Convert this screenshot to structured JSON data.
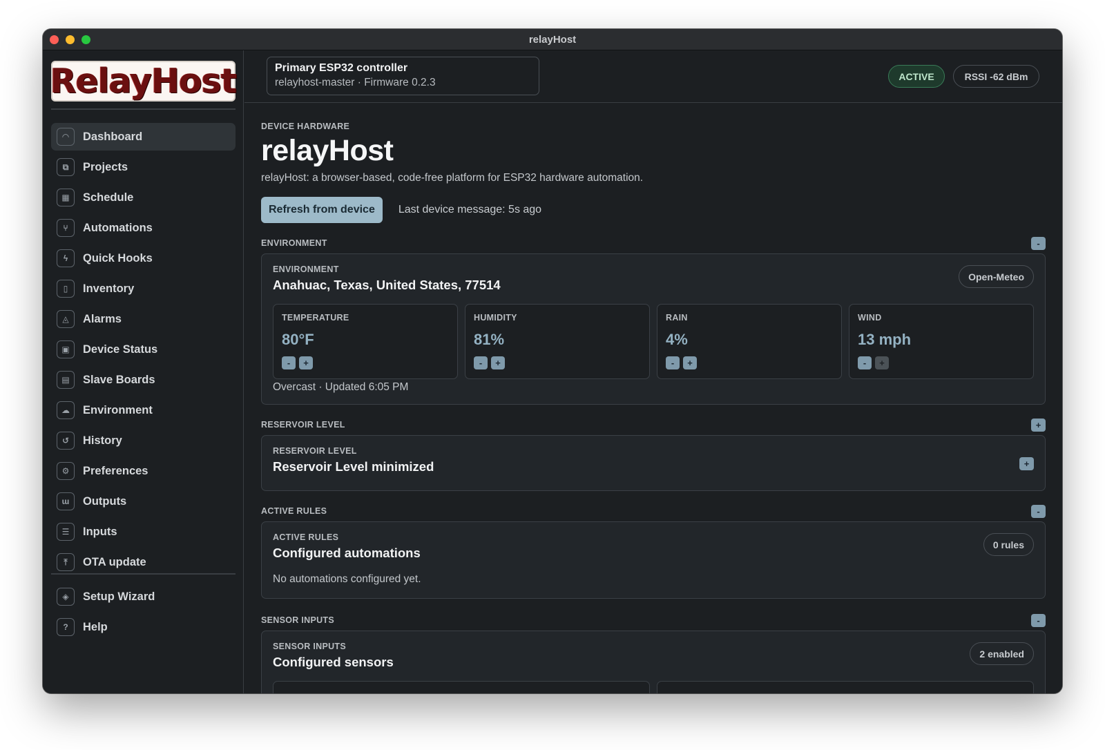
{
  "window": {
    "title": "relayHost"
  },
  "sidebar": {
    "logo_text": "RelayHost",
    "items": [
      {
        "label": "Dashboard",
        "icon": "gauge-icon",
        "glyph": "◠",
        "active": true
      },
      {
        "label": "Projects",
        "icon": "projects-icon",
        "glyph": "⧉"
      },
      {
        "label": "Schedule",
        "icon": "schedule-icon",
        "glyph": "▦"
      },
      {
        "label": "Automations",
        "icon": "automations-icon",
        "glyph": "⑂"
      },
      {
        "label": "Quick Hooks",
        "icon": "bolt-icon",
        "glyph": "ϟ"
      },
      {
        "label": "Inventory",
        "icon": "inventory-icon",
        "glyph": "▯"
      },
      {
        "label": "Alarms",
        "icon": "bell-icon",
        "glyph": "◬"
      },
      {
        "label": "Device Status",
        "icon": "chip-icon",
        "glyph": "▣"
      },
      {
        "label": "Slave Boards",
        "icon": "boards-icon",
        "glyph": "▤"
      },
      {
        "label": "Environment",
        "icon": "cloud-icon",
        "glyph": "☁"
      },
      {
        "label": "History",
        "icon": "history-icon",
        "glyph": "↺"
      },
      {
        "label": "Preferences",
        "icon": "gear-icon",
        "glyph": "⚙"
      },
      {
        "label": "Outputs",
        "icon": "outputs-icon",
        "glyph": "ɯ"
      },
      {
        "label": "Inputs",
        "icon": "inputs-icon",
        "glyph": "☰"
      },
      {
        "label": "OTA update",
        "icon": "upload-icon",
        "glyph": "⤒"
      }
    ],
    "footer_items": [
      {
        "label": "Setup Wizard",
        "icon": "layers-icon",
        "glyph": "◈"
      },
      {
        "label": "Help",
        "icon": "help-icon",
        "glyph": "?"
      }
    ]
  },
  "topbar": {
    "device_name": "Primary ESP32 controller",
    "device_sub": "relayhost-master · Firmware 0.2.3",
    "status": "ACTIVE",
    "rssi": "RSSI -62 dBm"
  },
  "header": {
    "eyebrow": "DEVICE HARDWARE",
    "title": "relayHost",
    "description": "relayHost: a browser-based, code-free platform for ESP32 hardware automation.",
    "refresh_label": "Refresh from device",
    "last_message": "Last device message: 5s ago"
  },
  "environment": {
    "section_label": "ENVIRONMENT",
    "toggle": "-",
    "card_eyebrow": "ENVIRONMENT",
    "location": "Anahuac, Texas, United States, 77514",
    "provider": "Open-Meteo",
    "metrics": [
      {
        "label": "TEMPERATURE",
        "value": "80°F"
      },
      {
        "label": "HUMIDITY",
        "value": "81%"
      },
      {
        "label": "RAIN",
        "value": "4%"
      },
      {
        "label": "WIND",
        "value": "13 mph"
      }
    ],
    "minus": "-",
    "plus": "+",
    "footer": "Overcast · Updated 6:05 PM"
  },
  "reservoir": {
    "section_label": "RESERVOIR LEVEL",
    "toggle": "+",
    "card_eyebrow": "RESERVOIR LEVEL",
    "title": "Reservoir Level minimized",
    "expand": "+"
  },
  "rules": {
    "section_label": "ACTIVE RULES",
    "toggle": "-",
    "card_eyebrow": "ACTIVE RULES",
    "title": "Configured automations",
    "count": "0 rules",
    "empty": "No automations configured yet."
  },
  "sensors": {
    "section_label": "SENSOR INPUTS",
    "toggle": "-",
    "card_eyebrow": "SENSOR INPUTS",
    "title": "Configured sensors",
    "count": "2 enabled"
  }
}
